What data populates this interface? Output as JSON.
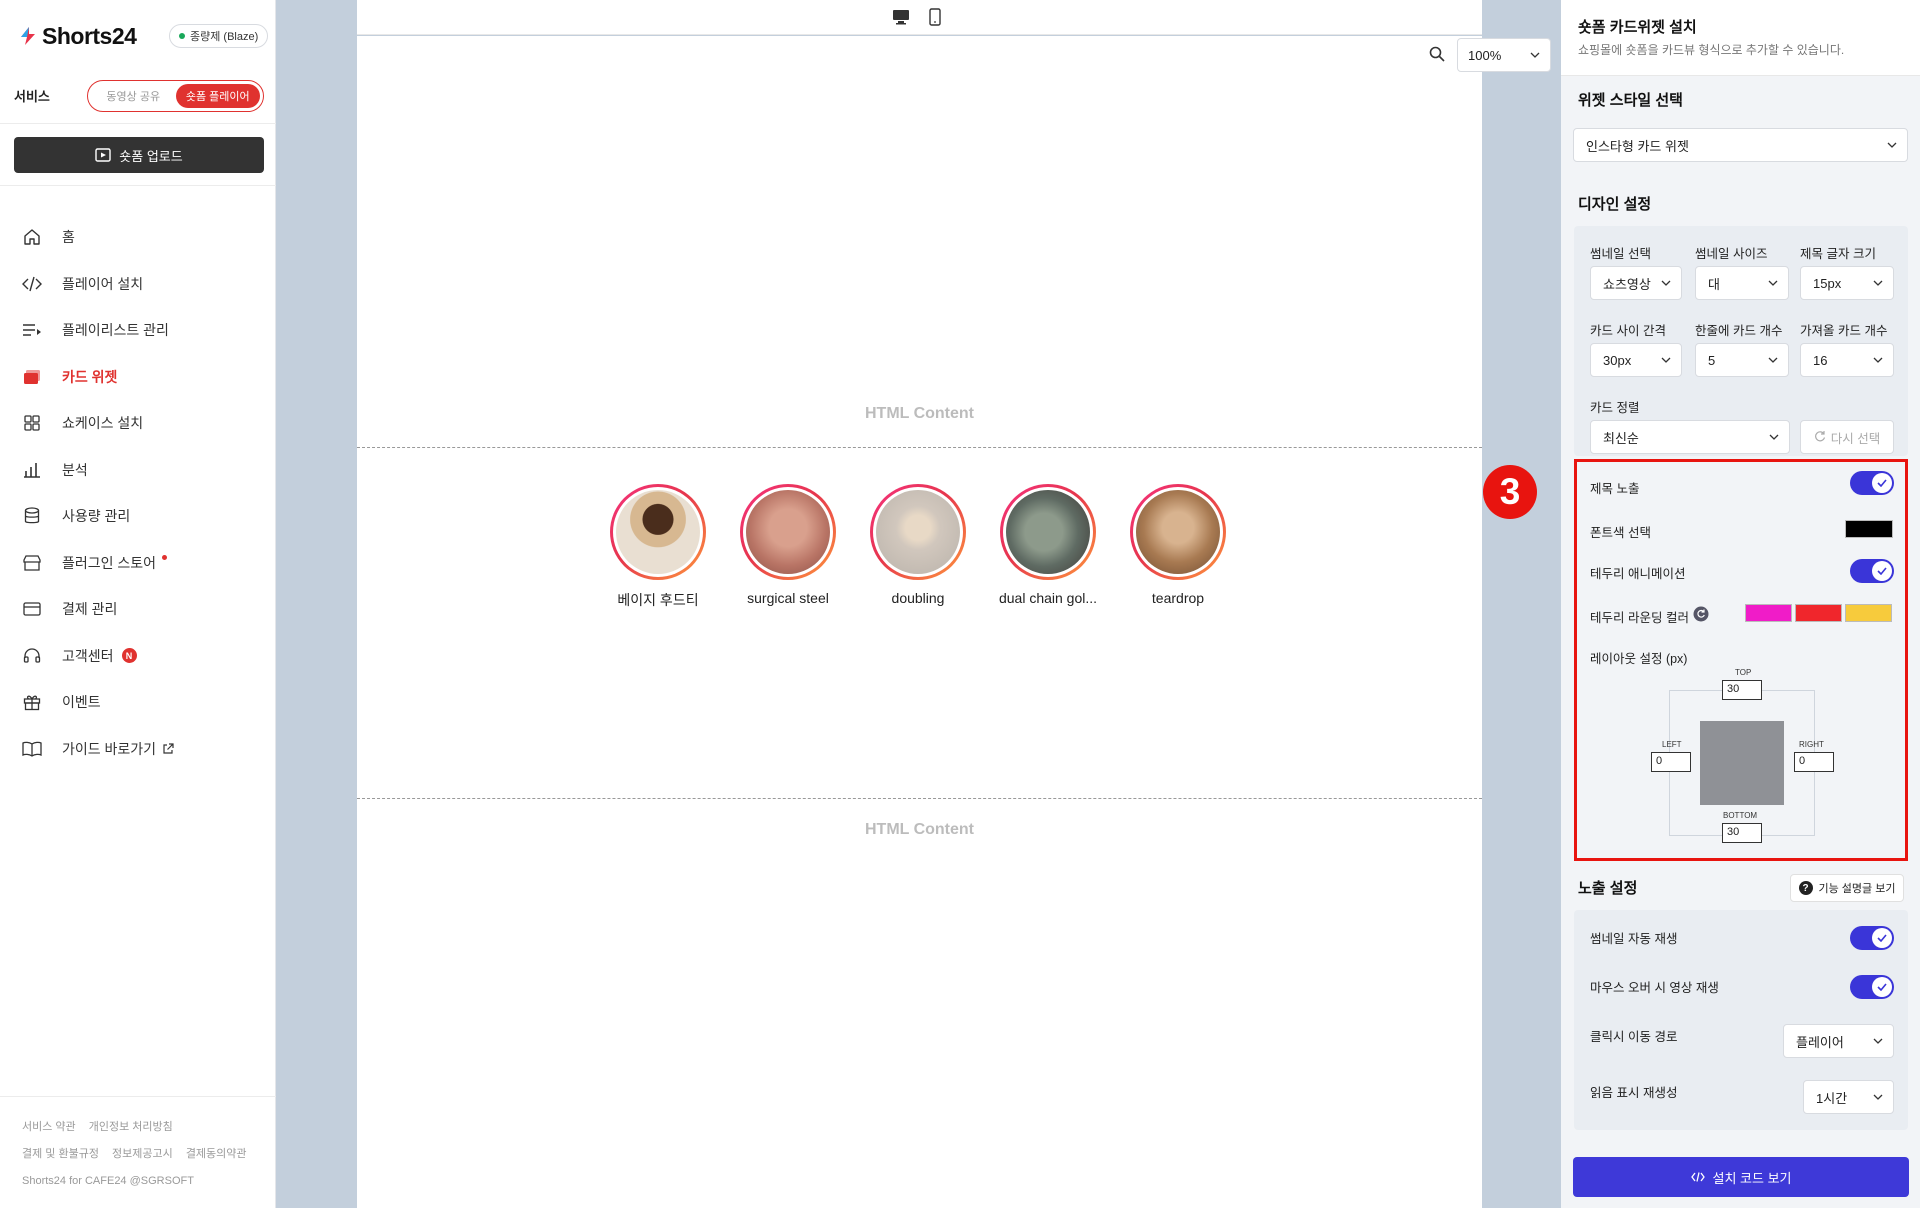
{
  "brand": {
    "name": "Shorts24",
    "plan": "종량제 (Blaze)"
  },
  "service": {
    "label": "서비스",
    "tabs": [
      "동영상 공유",
      "숏폼 플레이어"
    ]
  },
  "upload_button": "숏폼 업로드",
  "nav": [
    {
      "label": "홈",
      "icon": "home-icon"
    },
    {
      "label": "플레이어 설치",
      "icon": "code-icon"
    },
    {
      "label": "플레이리스트 관리",
      "icon": "playlist-icon"
    },
    {
      "label": "카드 위젯",
      "icon": "card-widget-icon",
      "active": true
    },
    {
      "label": "쇼케이스 설치",
      "icon": "grid-icon"
    },
    {
      "label": "분석",
      "icon": "bar-chart-icon"
    },
    {
      "label": "사용량 관리",
      "icon": "database-icon"
    },
    {
      "label": "플러그인 스토어",
      "icon": "store-icon"
    },
    {
      "label": "결제 관리",
      "icon": "credit-card-icon"
    },
    {
      "label": "고객센터",
      "icon": "headset-icon",
      "badge": "N"
    },
    {
      "label": "이벤트",
      "icon": "gift-icon"
    },
    {
      "label": "가이드 바로가기",
      "icon": "book-icon"
    }
  ],
  "footer": {
    "row1": [
      "서비스 약관",
      "개인정보 처리방침"
    ],
    "row2": [
      "결제 및 환불규정",
      "정보제공고시",
      "결제동의약관"
    ],
    "copyright": "Shorts24 for CAFE24 @SGRSOFT"
  },
  "canvas": {
    "zoom": "100%",
    "html_content_label": "HTML Content",
    "cards": [
      {
        "title": "베이지 후드티",
        "color": "#b89a78"
      },
      {
        "title": "surgical steel",
        "color": "#c48a78"
      },
      {
        "title": "doubling",
        "color": "#c9c2b8"
      },
      {
        "title": "dual chain gol...",
        "color": "#7f8a80"
      },
      {
        "title": "teardrop",
        "color": "#b88a62"
      }
    ]
  },
  "panel": {
    "title": "숏폼 카드위젯 설치",
    "subtitle": "쇼핑몰에 숏폼을 카드뷰 형식으로 추가할 수 있습니다.",
    "style_section": "위젯 스타일 선택",
    "style_value": "인스타형 카드 위젯",
    "design_section": "디자인 설정",
    "fields": {
      "thumb_select": {
        "label": "썸네일 선택",
        "value": "쇼츠영상"
      },
      "thumb_size": {
        "label": "썸네일 사이즈",
        "value": "대"
      },
      "title_font": {
        "label": "제목 글자 크기",
        "value": "15px"
      },
      "card_gap": {
        "label": "카드 사이 간격",
        "value": "30px"
      },
      "cards_per_row": {
        "label": "한줄에 카드 개수",
        "value": "5"
      },
      "fetch_count": {
        "label": "가져올 카드 개수",
        "value": "16"
      },
      "sort": {
        "label": "카드 정렬",
        "value": "최신순"
      }
    },
    "reselect": "다시 선택",
    "step_number": "3",
    "show_title": "제목 노출",
    "font_color": {
      "label": "폰트색 선택",
      "value": "#000000"
    },
    "border_anim": "테두리 애니메이션",
    "border_colors": {
      "label": "테두리 라운딩 컬러",
      "values": [
        "#f01cc8",
        "#f0262c",
        "#f7cb3c"
      ]
    },
    "layout": {
      "label": "레이아웃 설정 (px)",
      "top_label": "TOP",
      "bottom_label": "BOTTOM",
      "left_label": "LEFT",
      "right_label": "RIGHT",
      "top": "30",
      "bottom": "30",
      "left": "0",
      "right": "0"
    },
    "exposure_section": "노출 설정",
    "help_button": "기능 설명글 보기",
    "autoplay": "썸네일 자동 재생",
    "hover_play": "마우스 오버 시 영상 재생",
    "click_path": {
      "label": "클릭시 이동 경로",
      "value": "플레이어"
    },
    "read_regen": {
      "label": "읽음 표시 재생성",
      "value": "1시간"
    },
    "install_button": "설치 코드 보기"
  }
}
